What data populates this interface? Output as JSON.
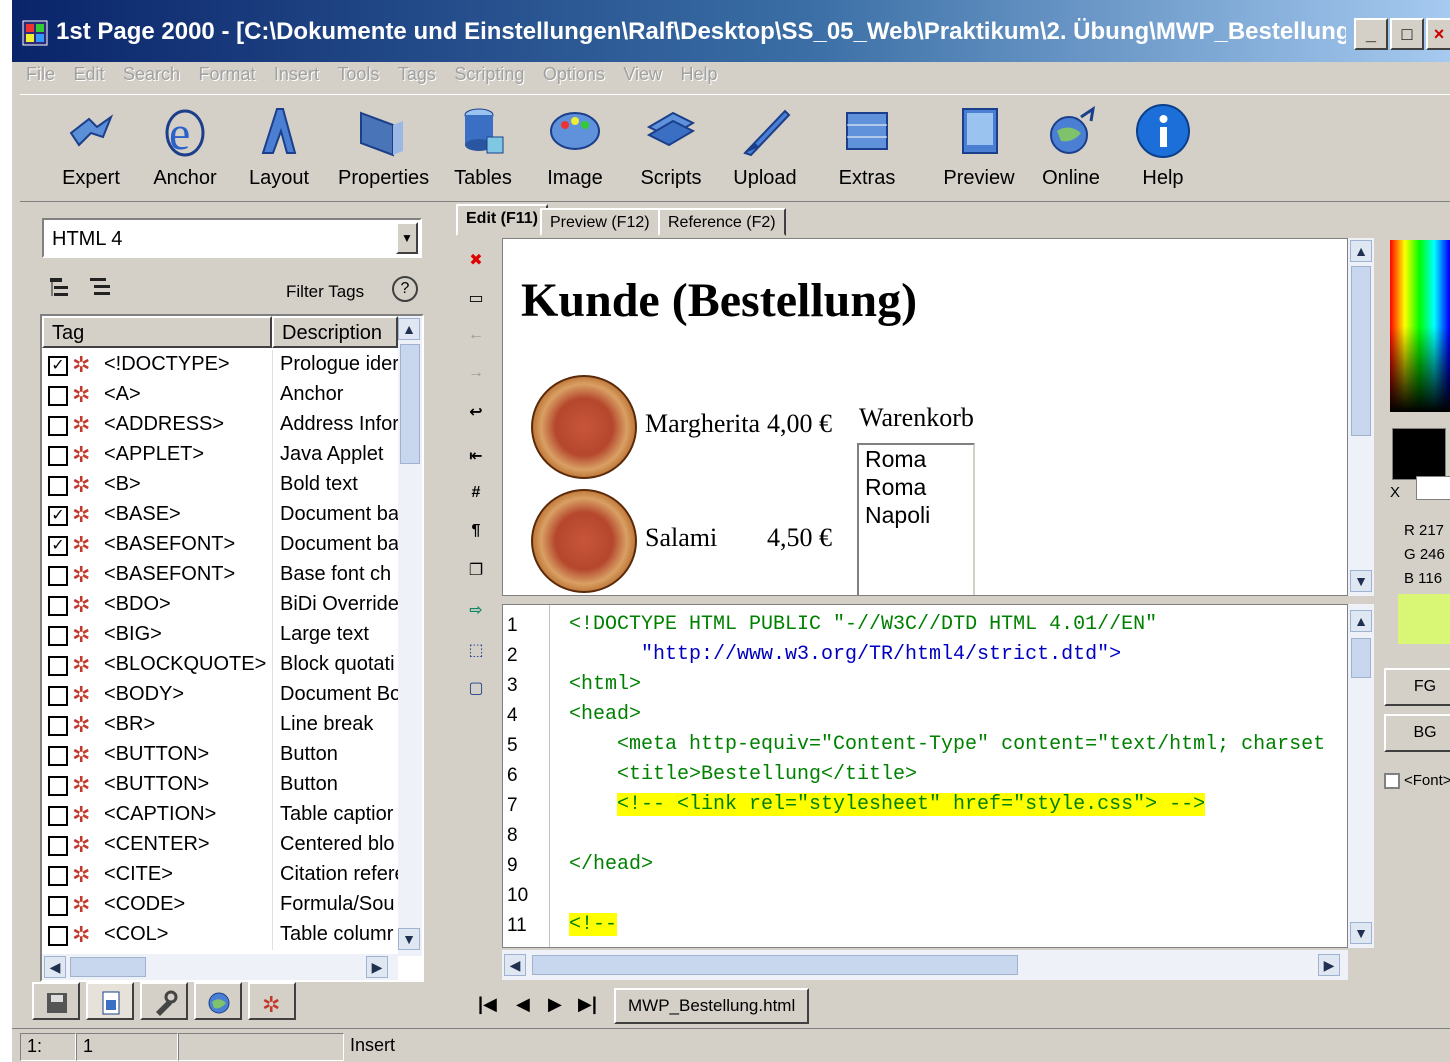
{
  "window": {
    "title": "1st Page 2000 - [C:\\Dokumente und Einstellungen\\Ralf\\Desktop\\SS_05_Web\\Praktikum\\2. Übung\\MWP_Bestellung....",
    "minimize": "_",
    "maximize": "□",
    "close": "×"
  },
  "menu": [
    "File",
    "Edit",
    "Search",
    "Format",
    "Insert",
    "Tools",
    "Tags",
    "Scripting",
    "Options",
    "View",
    "Help"
  ],
  "toolbar": [
    {
      "label": "Expert",
      "icon": "expert-icon"
    },
    {
      "label": "Anchor",
      "icon": "anchor-icon"
    },
    {
      "label": "Layout",
      "icon": "layout-icon"
    },
    {
      "label": "Properties",
      "icon": "properties-icon"
    },
    {
      "label": "Tables",
      "icon": "tables-icon"
    },
    {
      "label": "Image",
      "icon": "image-icon"
    },
    {
      "label": "Scripts",
      "icon": "scripts-icon"
    },
    {
      "label": "Upload",
      "icon": "upload-icon"
    },
    {
      "label": "Extras",
      "icon": "extras-icon"
    },
    {
      "label": "Preview",
      "icon": "preview-icon"
    },
    {
      "label": "Online",
      "icon": "online-icon"
    },
    {
      "label": "Help",
      "icon": "help-icon"
    }
  ],
  "left": {
    "html_version": "HTML 4",
    "filter_label": "Filter Tags",
    "help": "?",
    "col_tag": "Tag",
    "col_desc": "Description",
    "tags": [
      {
        "tag": "<!DOCTYPE>",
        "desc": "Prologue ider",
        "checked": true
      },
      {
        "tag": "<A>",
        "desc": "Anchor",
        "checked": false
      },
      {
        "tag": "<ADDRESS>",
        "desc": "Address Infor",
        "checked": false
      },
      {
        "tag": "<APPLET>",
        "desc": "Java Applet",
        "checked": false
      },
      {
        "tag": "<B>",
        "desc": "Bold text",
        "checked": false
      },
      {
        "tag": "<BASE>",
        "desc": "Document ba",
        "checked": true
      },
      {
        "tag": "<BASEFONT>",
        "desc": "Document ba",
        "checked": true
      },
      {
        "tag": "<BASEFONT>",
        "desc": "Base font ch",
        "checked": false
      },
      {
        "tag": "<BDO>",
        "desc": "BiDi Override",
        "checked": false
      },
      {
        "tag": "<BIG>",
        "desc": "Large text",
        "checked": false
      },
      {
        "tag": "<BLOCKQUOTE>",
        "desc": "Block quotati",
        "checked": false
      },
      {
        "tag": "<BODY>",
        "desc": "Document Bo",
        "checked": false
      },
      {
        "tag": "<BR>",
        "desc": "Line break",
        "checked": false
      },
      {
        "tag": "<BUTTON>",
        "desc": "Button",
        "checked": false
      },
      {
        "tag": "<BUTTON>",
        "desc": "Button",
        "checked": false
      },
      {
        "tag": "<CAPTION>",
        "desc": "Table captior",
        "checked": false
      },
      {
        "tag": "<CENTER>",
        "desc": "Centered blo",
        "checked": false
      },
      {
        "tag": "<CITE>",
        "desc": "Citation refere",
        "checked": false
      },
      {
        "tag": "<CODE>",
        "desc": "Formula/Sou",
        "checked": false
      },
      {
        "tag": "<COL>",
        "desc": "Table columr",
        "checked": false
      }
    ]
  },
  "editor_tabs": [
    {
      "label": "Edit (F11)",
      "active": true
    },
    {
      "label": "Preview (F12)",
      "active": false
    },
    {
      "label": "Reference (F2)",
      "active": false
    }
  ],
  "preview": {
    "heading": "Kunde (Bestellung)",
    "items": [
      {
        "name": "Margherita",
        "price": "4,00 €"
      },
      {
        "name": "Salami",
        "price": "4,50 €"
      }
    ],
    "cart_label": "Warenkorb",
    "cart_items": [
      "Roma",
      "Roma",
      "Napoli"
    ]
  },
  "code_lines": [
    {
      "n": "1",
      "text": "<!DOCTYPE HTML PUBLIC \"-//W3C//DTD HTML 4.01//EN\"",
      "indent": 0
    },
    {
      "n": "2",
      "text": "\"http://www.w3.org/TR/html4/strict.dtd\">",
      "indent": 3
    },
    {
      "n": "3",
      "text": "<html>",
      "indent": 0
    },
    {
      "n": "4",
      "text": "<head>",
      "indent": 0
    },
    {
      "n": "5",
      "text": "<meta http-equiv=\"Content-Type\" content=\"text/html; charset",
      "indent": 2
    },
    {
      "n": "6",
      "text": "<title>Bestellung</title>",
      "indent": 2
    },
    {
      "n": "7",
      "text": "<!-- <link rel=\"stylesheet\" href=\"style.css\"> -->",
      "indent": 2,
      "highlight": true
    },
    {
      "n": "8",
      "text": "",
      "indent": 0
    },
    {
      "n": "9",
      "text": "</head>",
      "indent": 0
    },
    {
      "n": "10",
      "text": "",
      "indent": 0
    },
    {
      "n": "11",
      "text": "<!--",
      "indent": 0,
      "highlight": true
    }
  ],
  "file_tab": "MWP_Bestellung.html",
  "nav": {
    "first": "|◀",
    "prev": "◀",
    "next": "▶",
    "last": "▶|"
  },
  "color": {
    "x_label": "X",
    "r": "R 217",
    "g": "G 246",
    "b": "B 116",
    "preview_hex": "#d9f674",
    "fg": "FG",
    "bg": "BG",
    "font_chk": "<Font>"
  },
  "status": {
    "pos_line": "1:",
    "pos_col": "1",
    "mode": "Insert"
  }
}
